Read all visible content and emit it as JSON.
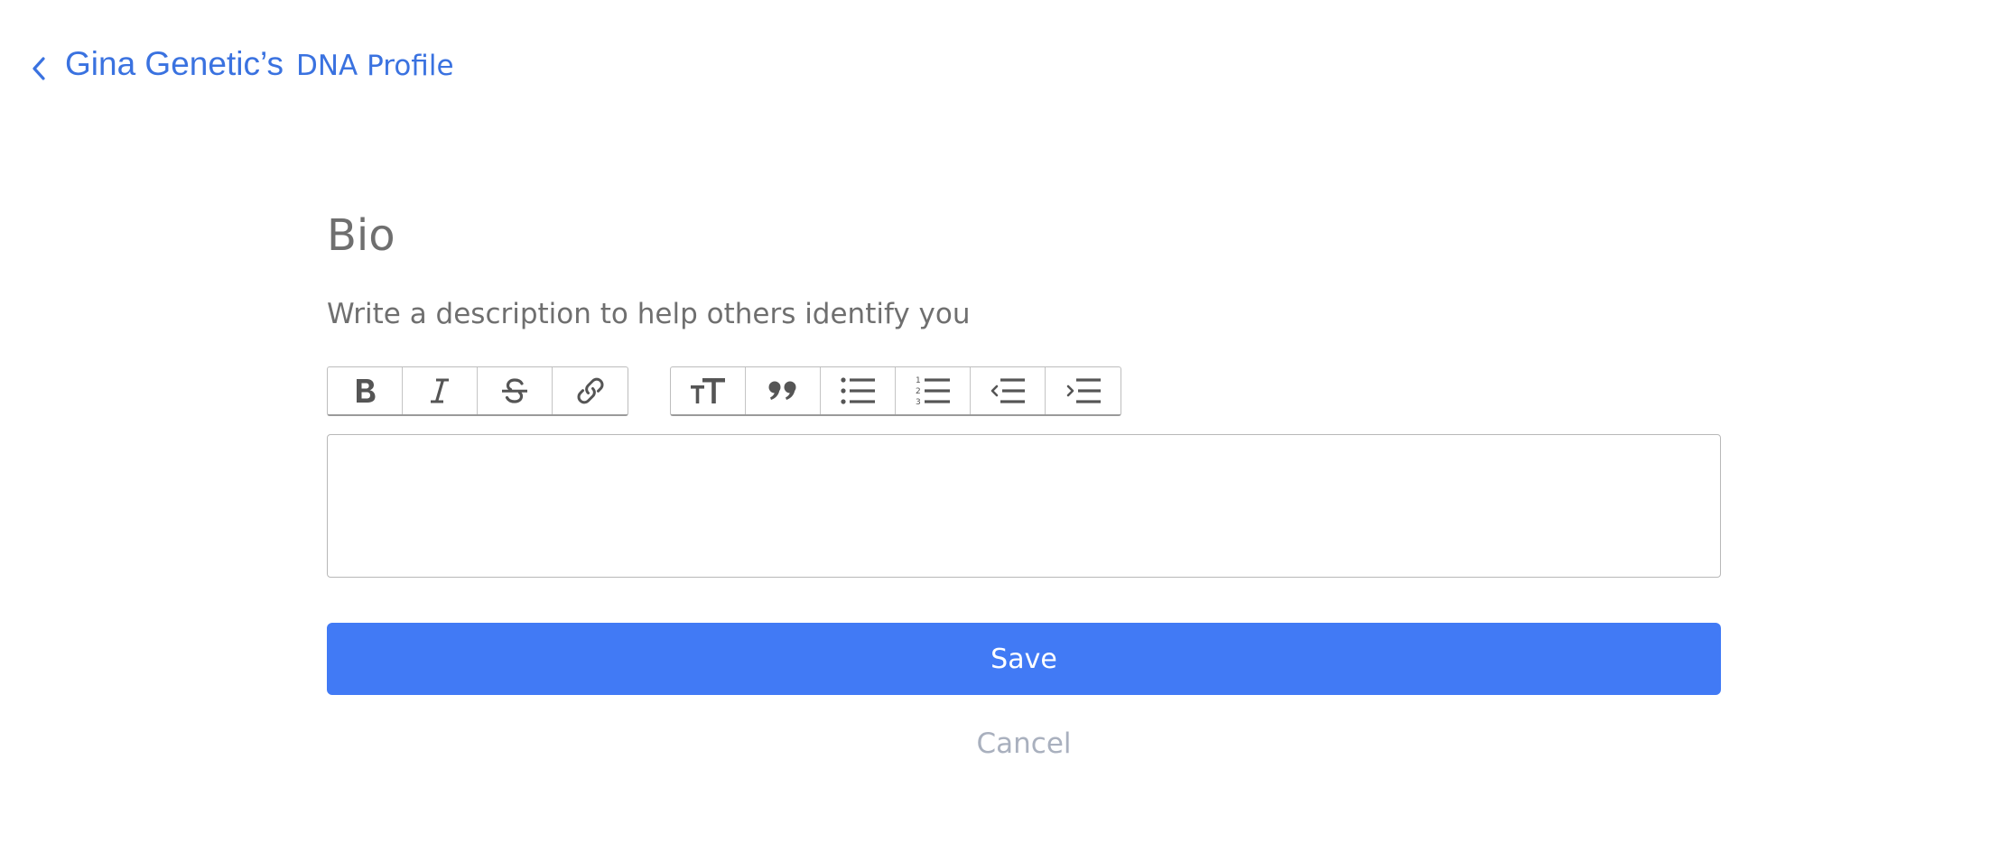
{
  "breadcrumb": {
    "chevron_icon": "chevron-left-icon",
    "name": "Gina Genetic’s",
    "suffix": "DNA Profile",
    "color": "#3a72e0"
  },
  "bio": {
    "title": "Bio",
    "description": "Write a description to help others identify you",
    "editor_value": ""
  },
  "toolbar": {
    "groups": [
      {
        "name": "text-style",
        "buttons": [
          {
            "icon": "bold-icon"
          },
          {
            "icon": "italic-icon"
          },
          {
            "icon": "strikethrough-icon"
          },
          {
            "icon": "link-icon"
          }
        ]
      },
      {
        "name": "block",
        "buttons": [
          {
            "icon": "heading-icon"
          },
          {
            "icon": "quote-icon"
          },
          {
            "icon": "bullet-list-icon"
          },
          {
            "icon": "numbered-list-icon"
          },
          {
            "icon": "outdent-icon"
          },
          {
            "icon": "indent-icon"
          }
        ]
      }
    ]
  },
  "actions": {
    "save_label": "Save",
    "cancel_label": "Cancel",
    "save_color": "#417af5",
    "cancel_color": "#a9b0be"
  }
}
